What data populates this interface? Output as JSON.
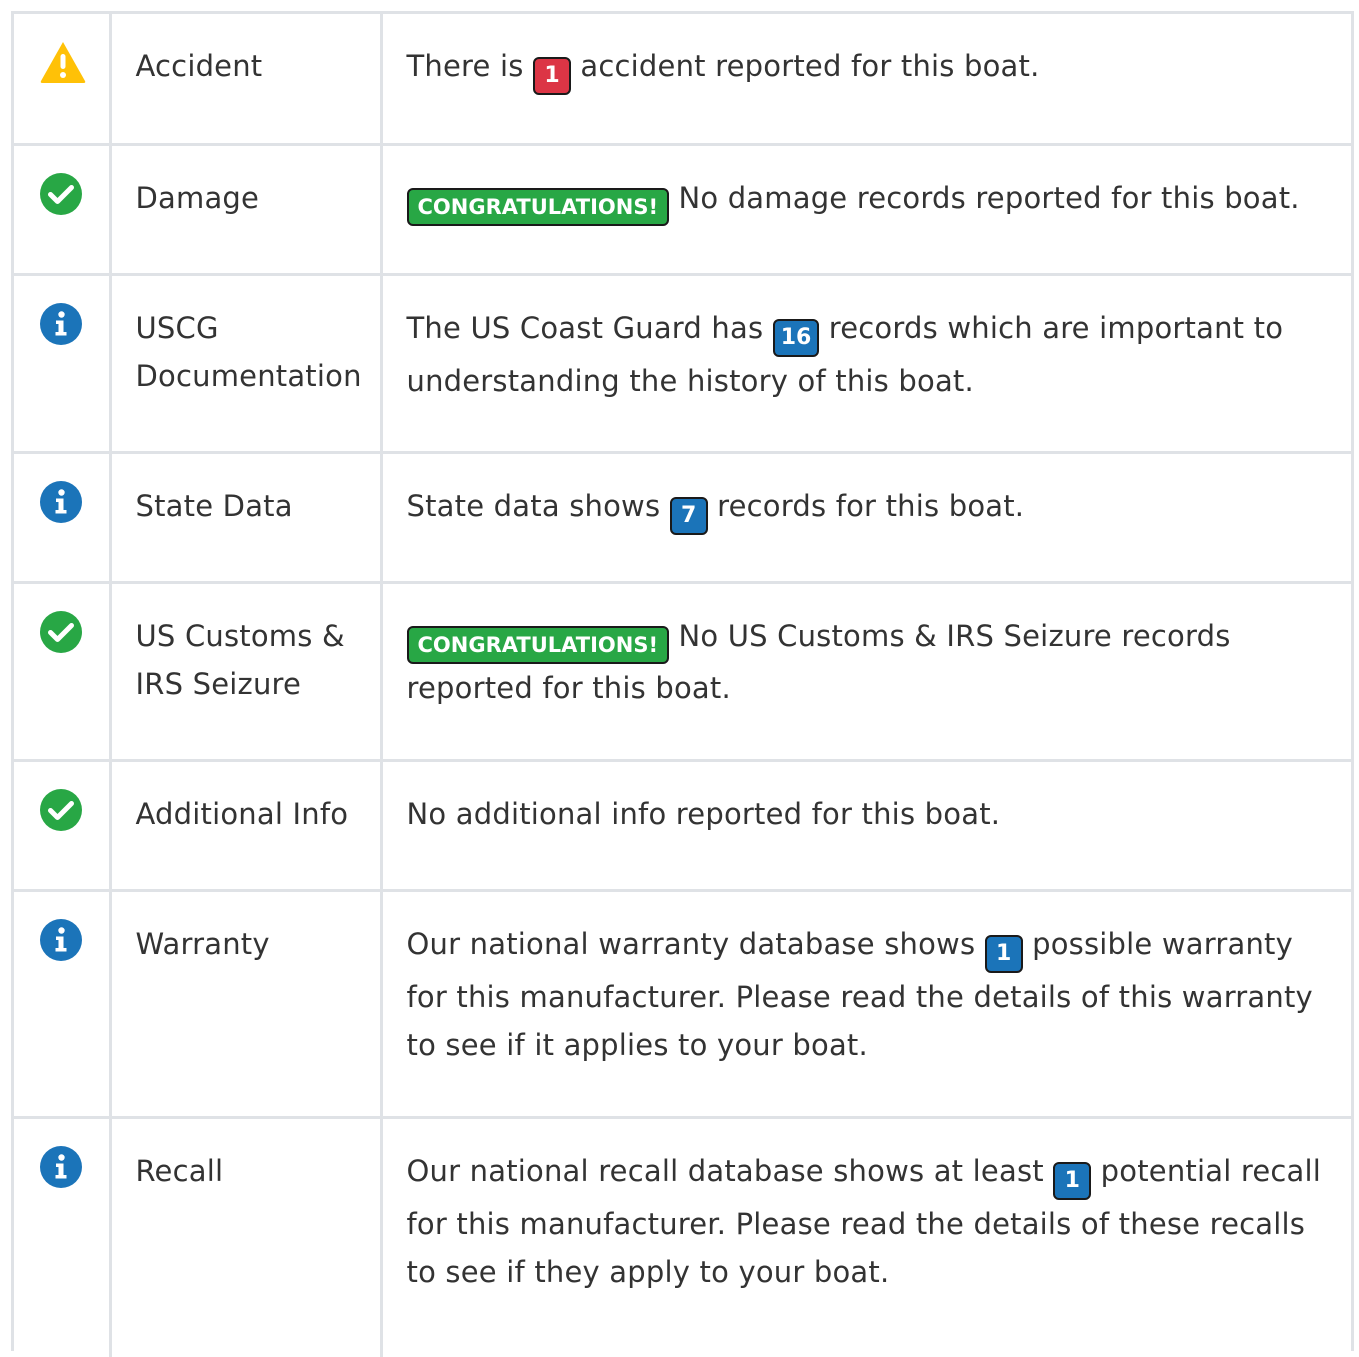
{
  "colors": {
    "warning": "#ffc107",
    "success": "#28a745",
    "info": "#1b74b9",
    "danger": "#dc3545",
    "border": "#dfe2e6"
  },
  "rows": [
    {
      "icon": "warning-triangle-icon",
      "label": "Accident",
      "pre": "There is",
      "badge": "1",
      "post": "accident reported for this boat."
    },
    {
      "icon": "check-circle-icon",
      "label": "Damage",
      "badge": "CONGRATULATIONS!",
      "post": "No damage records reported for this boat."
    },
    {
      "icon": "info-circle-icon",
      "label": "USCG Documentation",
      "pre": "The US Coast Guard has",
      "badge": "16",
      "post": "records which are important to understanding the history of this boat."
    },
    {
      "icon": "info-circle-icon",
      "label": "State Data",
      "pre": "State data shows",
      "badge": "7",
      "post": "records for this boat."
    },
    {
      "icon": "check-circle-icon",
      "label": "US Customs & IRS Seizure",
      "badge": "CONGRATULATIONS!",
      "post": "No US Customs & IRS Seizure records reported for this boat."
    },
    {
      "icon": "check-circle-icon",
      "label": "Additional Info",
      "text": "No additional info reported for this boat."
    },
    {
      "icon": "info-circle-icon",
      "label": "Warranty",
      "pre": "Our national warranty database shows",
      "badge": "1",
      "post": "possible warranty for this manufacturer. Please read the details of this warranty to see if it applies to your boat."
    },
    {
      "icon": "info-circle-icon",
      "label": "Recall",
      "pre": "Our national recall database shows at least",
      "badge": "1",
      "post": "potential recall for this manufacturer. Please read the details of these recalls to see if they apply to your boat."
    }
  ]
}
